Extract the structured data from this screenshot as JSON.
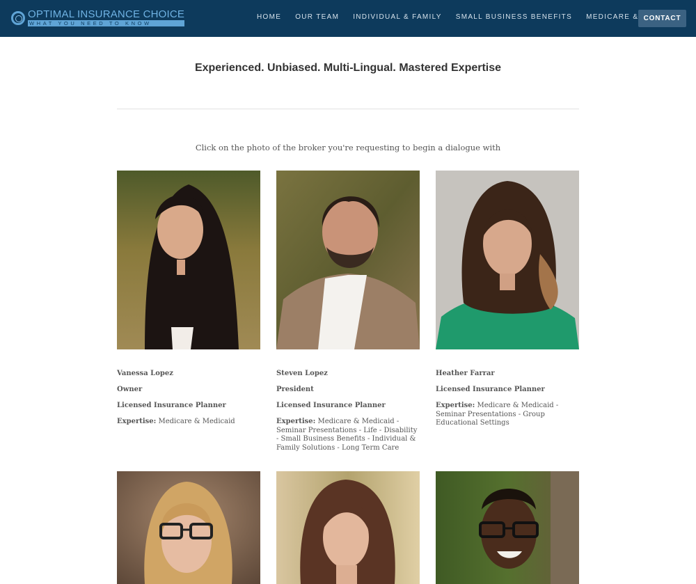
{
  "header": {
    "logo_title": "OPTIMAL INSURANCE CHOICE",
    "logo_tagline": "WHAT YOU NEED TO KNOW",
    "nav": [
      "HOME",
      "OUR TEAM",
      "INDIVIDUAL & FAMILY",
      "SMALL BUSINESS BENEFITS",
      "MEDICARE & MEDICAID"
    ],
    "contact_label": "CONTACT"
  },
  "main": {
    "tagline": "Experienced. Unbiased. Multi-Lingual. Mastered Expertise",
    "intro": "Click on the photo of the broker you're requesting to begin a dialogue with"
  },
  "team": [
    {
      "name": "Vanessa Lopez",
      "titles": [
        "Owner",
        "Licensed Insurance Planner"
      ],
      "expertise_label": "Expertise:",
      "expertise": "Medicare & Medicaid"
    },
    {
      "name": "Steven Lopez",
      "titles": [
        "President",
        "Licensed Insurance Planner"
      ],
      "expertise_label": "Expertise:",
      "expertise": "Medicare & Medicaid - Seminar Presentations - Life - Disability - Small Business Benefits - Individual & Family Solutions - Long Term Care"
    },
    {
      "name": "Heather Farrar",
      "titles": [
        "Licensed Insurance Planner"
      ],
      "expertise_label": "Expertise:",
      "expertise": "Medicare & Medicaid - Seminar Presentations - Group Educational Settings"
    }
  ],
  "colors": {
    "header_bg": "#0d3a5c",
    "logo_accent": "#5fa4d6",
    "contact_bg": "#3b6282"
  }
}
